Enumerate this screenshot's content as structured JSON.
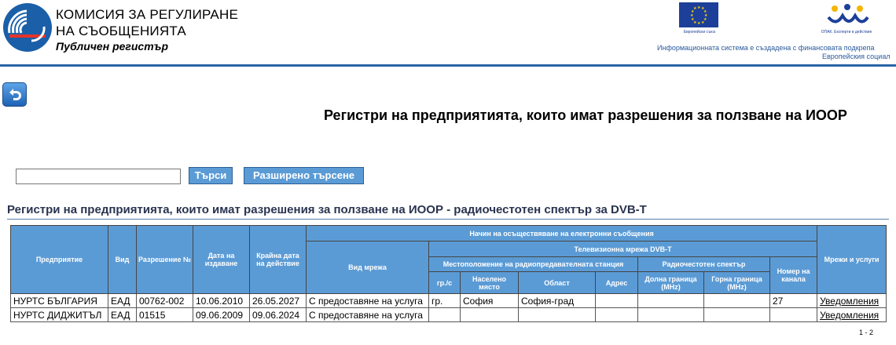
{
  "header": {
    "org_line1": "КОМИСИЯ ЗА РЕГУЛИРАНЕ",
    "org_line2": "НА СЪОБЩЕНИЯТА",
    "org_subtitle": "Публичен регистър",
    "eu_caption": "Европейски съюз",
    "opak_caption": "ОПАК. Експерти в действие",
    "info_line1": "Информационната система е създадена с финансовата подкрепа",
    "info_line2": "Европейския социал"
  },
  "page_title": "Регистри на предприятията, които имат разрешения за ползване на ИООР",
  "search": {
    "placeholder": "",
    "value": "",
    "search_button": "Търси",
    "advanced_button": "Разширено търсене"
  },
  "section_title": "Регистри на предприятията, които имат разрешения за ползване на ИООР - радиочестотен спектър за DVB-T",
  "table": {
    "headers": {
      "enterprise": "Предприятие",
      "type": "Вид",
      "permit_no": "Разрешение №",
      "issue_date": "Дата на издаване",
      "end_date": "Крайна дата на действие",
      "method": "Начин на осъществяване на електронни съобщения",
      "tv_network": "Телевизионна мрежа DVB-T",
      "network_type": "Вид мрежа",
      "station_location": "Местоположение на радиопредавателната станция",
      "spectrum": "Радиочестотен спектър",
      "channel_no": "Номер на канала",
      "networks_services": "Мрежи и услуги",
      "town_type": "гр./с",
      "settlement": "Населено място",
      "region": "Област",
      "address": "Адрес",
      "lower_bound": "Долна граница (MHz)",
      "upper_bound": "Горна граница (MHz)"
    },
    "rows": [
      {
        "enterprise": "НУРТС БЪЛГАРИЯ",
        "type": "ЕАД",
        "permit_no": "00762-002",
        "issue_date": "10.06.2010",
        "end_date": "26.05.2027",
        "network_type": "С предоставяне на услуга",
        "town_type": "гр.",
        "settlement": "София",
        "region": "София-град",
        "address": "",
        "lower_bound": "",
        "upper_bound": "",
        "channel_no": "27",
        "link": "Уведомления"
      },
      {
        "enterprise": "НУРТС ДИДЖИТЪЛ",
        "type": "ЕАД",
        "permit_no": "01515",
        "issue_date": "09.06.2009",
        "end_date": "09.06.2024",
        "network_type": "С предоставяне на услуга",
        "town_type": "",
        "settlement": "",
        "region": "",
        "address": "",
        "lower_bound": "",
        "upper_bound": "",
        "channel_no": "",
        "link": "Уведомления"
      }
    ]
  },
  "pager": "1 - 2",
  "colors": {
    "header_blue": "#5b9bd5",
    "rule_blue": "#2b63a8"
  }
}
